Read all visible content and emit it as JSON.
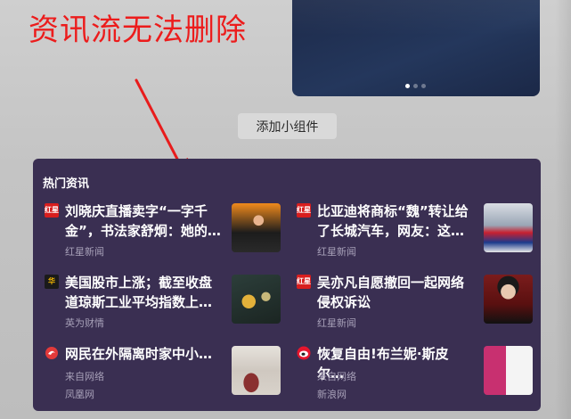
{
  "annotation": {
    "text": "资讯流无法删除",
    "color": "#ec1c1c"
  },
  "photo_widget": {
    "dots_total": 3,
    "active_dot": 1
  },
  "add_widget": {
    "label": "添加小组件"
  },
  "news_panel": {
    "title": "热门资讯",
    "items": [
      {
        "source_icon": "hongxing-icon",
        "icon_text": "红星",
        "headline": "刘晓庆直播卖字“一字千金”，书法家舒炯：她的…",
        "source": "红星新闻",
        "via": ""
      },
      {
        "source_icon": "hongxing-icon",
        "icon_text": "红星",
        "headline": "比亚迪将商标“魏”转让给了长城汽车，网友：这…",
        "source": "红星新闻",
        "via": ""
      },
      {
        "source_icon": "huawei-finance-icon",
        "icon_text": "华",
        "headline": "美国股市上涨；截至收盘道琼斯工业平均指数上…",
        "source": "英为财情",
        "via": ""
      },
      {
        "source_icon": "hongxing-icon",
        "icon_text": "红星",
        "headline": "吴亦凡自愿撤回一起网络侵权诉讼",
        "source": "红星新闻",
        "via": ""
      },
      {
        "source_icon": "ifeng-icon",
        "icon_text": "",
        "headline": "网民在外隔离时家中小…",
        "via": "来自网络",
        "source": "凤凰网"
      },
      {
        "source_icon": "sina-icon",
        "icon_text": "",
        "headline": "恢复自由!布兰妮·斯皮尔…",
        "via": "来自网络",
        "source": "新浪网"
      }
    ]
  },
  "colors": {
    "panel_bg": "#3a2f52",
    "headline": "#ffffff",
    "meta": "#a7a0b8"
  }
}
